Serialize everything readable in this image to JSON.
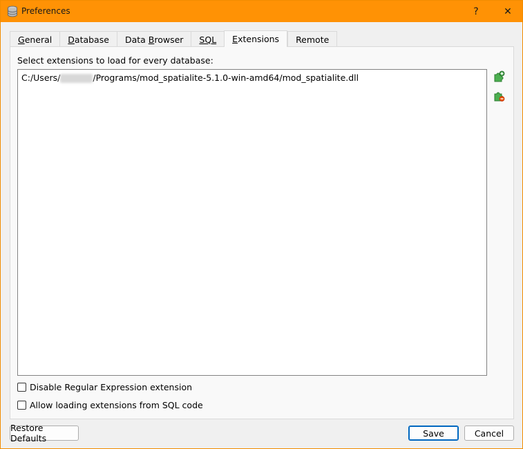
{
  "window": {
    "title": "Preferences",
    "help_label": "?",
    "close_label": "✕"
  },
  "tabs": [
    {
      "label": "General",
      "mnemonic": "G",
      "rest": "eneral",
      "active": false
    },
    {
      "label": "Database",
      "mnemonic": "D",
      "rest": "atabase",
      "active": false
    },
    {
      "label": "Data Browser",
      "mnemonic": "B",
      "rest": "rowser",
      "active": false
    },
    {
      "label": "SQL",
      "mnemonic": "SQL",
      "active": false
    },
    {
      "label": "Extensions",
      "mnemonic": "E",
      "rest": "xtensions",
      "active": true
    },
    {
      "label": "Remote",
      "active": false
    }
  ],
  "extensions": {
    "label": "Select extensions to load for every database:",
    "items": [
      {
        "prefix": "C:/Users/",
        "suffix": "/Programs/mod_spatialite-5.1.0-win-amd64/mod_spatialite.dll"
      }
    ],
    "add_icon": "add-extension-icon",
    "remove_icon": "remove-extension-icon"
  },
  "options": {
    "disable_regex": {
      "label": "Disable Regular Expression extension",
      "checked": false
    },
    "allow_sql_loading": {
      "label": "Allow loading extensions from SQL code",
      "checked": false
    }
  },
  "buttons": {
    "restore_defaults": "Restore Defaults",
    "save": "Save",
    "cancel": "Cancel"
  },
  "colors": {
    "titlebar": "#ff9205",
    "accent": "#0067c0"
  }
}
